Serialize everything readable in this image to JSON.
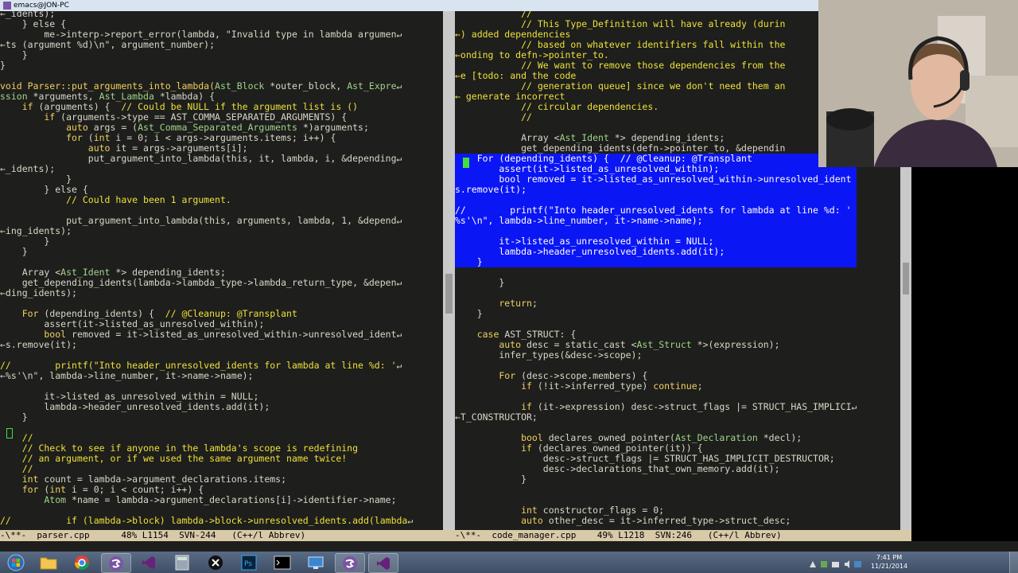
{
  "window": {
    "title": "emacs@JON-PC"
  },
  "colors": {
    "editor_bg": "#1e1e1c",
    "default_text": "#d8d8c8",
    "keyword_yellow": "#f0d060",
    "type_green": "#9fd48a",
    "comment_yellow": "#ede13a",
    "string_light": "#d8d8c8",
    "selection_blue": "#0b16f5",
    "modeline_bg": "#d8c9a8",
    "cursor_green": "#40e040"
  },
  "left_pane": {
    "lines": [
      [
        {
          "t": "←_idents);",
          "c": "n"
        }
      ],
      [
        {
          "t": "    } else {",
          "c": "n"
        }
      ],
      [
        {
          "t": "        me->interp->report_error(lambda, \"Invalid type in lambda argumen",
          "c": "n"
        },
        {
          "t": "↵",
          "c": "n"
        }
      ],
      [
        {
          "t": "←ts (argument %d)\\n\", argument_number);",
          "c": "n"
        }
      ],
      [
        {
          "t": "    }",
          "c": "n"
        }
      ],
      [
        {
          "t": "}",
          "c": "n"
        }
      ],
      [
        {
          "t": "",
          "c": "n"
        }
      ],
      [
        {
          "t": "void Parser::put_arguments_into_lambda(",
          "c": "k"
        },
        {
          "t": "Ast_Block",
          "c": "g"
        },
        {
          "t": " *outer_block, ",
          "c": "n"
        },
        {
          "t": "Ast_Expre",
          "c": "g"
        },
        {
          "t": "↵",
          "c": "n"
        }
      ],
      [
        {
          "t": "ssion",
          "c": "g"
        },
        {
          "t": " *arguments, ",
          "c": "n"
        },
        {
          "t": "Ast_Lambda",
          "c": "g"
        },
        {
          "t": " *lambda) {",
          "c": "n"
        }
      ],
      [
        {
          "t": "    if",
          "c": "k"
        },
        {
          "t": " (arguments) {  ",
          "c": "n"
        },
        {
          "t": "// Could be NULL if the argument list is ()",
          "c": "c"
        }
      ],
      [
        {
          "t": "        if",
          "c": "k"
        },
        {
          "t": " (arguments->type == AST_COMMA_SEPARATED_ARGUMENTS) {",
          "c": "n"
        }
      ],
      [
        {
          "t": "            auto",
          "c": "k"
        },
        {
          "t": " args = (",
          "c": "n"
        },
        {
          "t": "Ast_Comma_Separated_Arguments",
          "c": "g"
        },
        {
          "t": " *)arguments;",
          "c": "n"
        }
      ],
      [
        {
          "t": "            for",
          "c": "k"
        },
        {
          "t": " (",
          "c": "n"
        },
        {
          "t": "int",
          "c": "k"
        },
        {
          "t": " i = 0; i < args->arguments.items; i++) {",
          "c": "n"
        }
      ],
      [
        {
          "t": "                auto",
          "c": "k"
        },
        {
          "t": " it = args->arguments[i];",
          "c": "n"
        }
      ],
      [
        {
          "t": "                put_argument_into_lambda(this, it, lambda, i, &depending",
          "c": "n"
        },
        {
          "t": "↵",
          "c": "n"
        }
      ],
      [
        {
          "t": "←_idents);",
          "c": "n"
        }
      ],
      [
        {
          "t": "            }",
          "c": "n"
        }
      ],
      [
        {
          "t": "        } else {",
          "c": "n"
        }
      ],
      [
        {
          "t": "            ",
          "c": "n"
        },
        {
          "t": "// Could have been 1 argument.",
          "c": "c"
        }
      ],
      [
        {
          "t": "",
          "c": "n"
        }
      ],
      [
        {
          "t": "            put_argument_into_lambda(this, arguments, lambda, 1, &depend",
          "c": "n"
        },
        {
          "t": "↵",
          "c": "n"
        }
      ],
      [
        {
          "t": "←ing_idents);",
          "c": "n"
        }
      ],
      [
        {
          "t": "        }",
          "c": "n"
        }
      ],
      [
        {
          "t": "    }",
          "c": "n"
        }
      ],
      [
        {
          "t": "",
          "c": "n"
        }
      ],
      [
        {
          "t": "    Array <",
          "c": "n"
        },
        {
          "t": "Ast_Ident",
          "c": "g"
        },
        {
          "t": " *> depending_idents;",
          "c": "n"
        }
      ],
      [
        {
          "t": "    get_depending_idents(lambda->lambda_type->lambda_return_type, &depen",
          "c": "n"
        },
        {
          "t": "↵",
          "c": "n"
        }
      ],
      [
        {
          "t": "←ding_idents);",
          "c": "n"
        }
      ],
      [
        {
          "t": "",
          "c": "n"
        }
      ],
      [
        {
          "t": "    For",
          "c": "k"
        },
        {
          "t": " (depending_idents) {  ",
          "c": "n"
        },
        {
          "t": "// @Cleanup: @Transplant",
          "c": "c"
        }
      ],
      [
        {
          "t": "        assert(it->listed_as_unresolved_within);",
          "c": "n"
        }
      ],
      [
        {
          "t": "        bool",
          "c": "k"
        },
        {
          "t": " removed = it->listed_as_unresolved_within->unresolved_ident",
          "c": "n"
        },
        {
          "t": "↵",
          "c": "n"
        }
      ],
      [
        {
          "t": "←s.remove(it);",
          "c": "n"
        }
      ],
      [
        {
          "t": "",
          "c": "n"
        }
      ],
      [
        {
          "t": "//        printf(\"Into header_unresolved_idents for lambda at line %d: '",
          "c": "c"
        },
        {
          "t": "↵",
          "c": "n"
        }
      ],
      [
        {
          "t": "←%s'\\n\", lambda->line_number, it->name->name);",
          "c": "n"
        }
      ],
      [
        {
          "t": "",
          "c": "n"
        }
      ],
      [
        {
          "t": "        it->listed_as_unresolved_within = NULL;",
          "c": "n"
        }
      ],
      [
        {
          "t": "        lambda->header_unresolved_idents.add(it);",
          "c": "n"
        }
      ],
      [
        {
          "t": "    }",
          "c": "n"
        }
      ],
      [
        {
          "t": "",
          "c": "n"
        }
      ],
      [
        {
          "t": "    //",
          "c": "c"
        }
      ],
      [
        {
          "t": "    // Check to see if anyone in the lambda's scope is redefining",
          "c": "c"
        }
      ],
      [
        {
          "t": "    // an argument, or if we used the same argument name twice!",
          "c": "c"
        }
      ],
      [
        {
          "t": "    //",
          "c": "c"
        }
      ],
      [
        {
          "t": "    int",
          "c": "k"
        },
        {
          "t": " count = lambda->argument_declarations.items;",
          "c": "n"
        }
      ],
      [
        {
          "t": "    for",
          "c": "k"
        },
        {
          "t": " (",
          "c": "n"
        },
        {
          "t": "int",
          "c": "k"
        },
        {
          "t": " i = 0; i < count; i++) {",
          "c": "n"
        }
      ],
      [
        {
          "t": "        Atom",
          "c": "g"
        },
        {
          "t": " *name = lambda->argument_declarations[i]->identifier->name;",
          "c": "n"
        }
      ],
      [
        {
          "t": "",
          "c": "n"
        }
      ],
      [
        {
          "t": "//          if (lambda->block) lambda->block->unresolved_idents.add(lambda",
          "c": "c"
        },
        {
          "t": "↵",
          "c": "n"
        }
      ]
    ]
  },
  "right_pane": {
    "lines": [
      [
        {
          "t": "            //",
          "c": "c"
        }
      ],
      [
        {
          "t": "            // This Type_Definition will have already (durin",
          "c": "c"
        }
      ],
      [
        {
          "t": "←) added dependencies",
          "c": "c"
        }
      ],
      [
        {
          "t": "            // based on whatever identifiers fall within the",
          "c": "c"
        }
      ],
      [
        {
          "t": "←onding to defn->pointer_to.",
          "c": "c"
        }
      ],
      [
        {
          "t": "            // We want to remove those dependencies from the",
          "c": "c"
        }
      ],
      [
        {
          "t": "←e [todo: and the code",
          "c": "c"
        }
      ],
      [
        {
          "t": "            // generation queue] since we don't need them an",
          "c": "c"
        }
      ],
      [
        {
          "t": "← generate incorrect",
          "c": "c"
        }
      ],
      [
        {
          "t": "            // circular dependencies.",
          "c": "c"
        }
      ],
      [
        {
          "t": "            //",
          "c": "c"
        }
      ],
      [
        {
          "t": "",
          "c": "n"
        }
      ],
      [
        {
          "t": "            Array <",
          "c": "n"
        },
        {
          "t": "Ast_Ident",
          "c": "g"
        },
        {
          "t": " *> depending_idents;",
          "c": "n"
        }
      ],
      [
        {
          "t": "            get_depending_idents(defn->pointer_to, &dependin",
          "c": "n"
        }
      ],
      [
        {
          "t": "    For (depending_idents) {  // @Cleanup: @Transplant",
          "c": "n",
          "hl": true
        }
      ],
      [
        {
          "t": "        assert(it->listed_as_unresolved_within);",
          "c": "n",
          "hl": true
        }
      ],
      [
        {
          "t": "        bool removed = it->listed_as_unresolved_within->unresolved_ident",
          "c": "n",
          "hl": true
        }
      ],
      [
        {
          "t": "s.remove(it);",
          "c": "n",
          "hl": true
        }
      ],
      [
        {
          "t": "",
          "c": "n",
          "hl": true
        }
      ],
      [
        {
          "t": "//        printf(\"Into header_unresolved_idents for lambda at line %d: '",
          "c": "n",
          "hl": true
        }
      ],
      [
        {
          "t": "%s'\\n\", lambda->line_number, it->name->name);",
          "c": "n",
          "hl": true
        }
      ],
      [
        {
          "t": "",
          "c": "n",
          "hl": true
        }
      ],
      [
        {
          "t": "        it->listed_as_unresolved_within = NULL;",
          "c": "n",
          "hl": true
        }
      ],
      [
        {
          "t": "        lambda->header_unresolved_idents.add(it);",
          "c": "n",
          "hl": true
        }
      ],
      [
        {
          "t": "    }",
          "c": "n",
          "hl": true
        }
      ],
      [
        {
          "t": "",
          "c": "n"
        }
      ],
      [
        {
          "t": "        }",
          "c": "n"
        }
      ],
      [
        {
          "t": "",
          "c": "n"
        }
      ],
      [
        {
          "t": "        return",
          "c": "k"
        },
        {
          "t": ";",
          "c": "n"
        }
      ],
      [
        {
          "t": "    }",
          "c": "n"
        }
      ],
      [
        {
          "t": "",
          "c": "n"
        }
      ],
      [
        {
          "t": "    case",
          "c": "k"
        },
        {
          "t": " AST_STRUCT: {",
          "c": "n"
        }
      ],
      [
        {
          "t": "        auto",
          "c": "k"
        },
        {
          "t": " desc = static_cast <",
          "c": "n"
        },
        {
          "t": "Ast_Struct",
          "c": "g"
        },
        {
          "t": " *>(expression);",
          "c": "n"
        }
      ],
      [
        {
          "t": "        infer_types(&desc->scope);",
          "c": "n"
        }
      ],
      [
        {
          "t": "",
          "c": "n"
        }
      ],
      [
        {
          "t": "        For",
          "c": "k"
        },
        {
          "t": " (desc->scope.members) {",
          "c": "n"
        }
      ],
      [
        {
          "t": "            if",
          "c": "k"
        },
        {
          "t": " (!it->inferred_type) ",
          "c": "n"
        },
        {
          "t": "continue",
          "c": "k"
        },
        {
          "t": ";",
          "c": "n"
        }
      ],
      [
        {
          "t": "",
          "c": "n"
        }
      ],
      [
        {
          "t": "            if",
          "c": "k"
        },
        {
          "t": " (it->expression) desc->struct_flags |= STRUCT_HAS_IMPLICI",
          "c": "n"
        },
        {
          "t": "↵",
          "c": "n"
        }
      ],
      [
        {
          "t": "←T_CONSTRUCTOR;",
          "c": "n"
        }
      ],
      [
        {
          "t": "",
          "c": "n"
        }
      ],
      [
        {
          "t": "            bool",
          "c": "k"
        },
        {
          "t": " declares_owned_pointer(",
          "c": "n"
        },
        {
          "t": "Ast_Declaration",
          "c": "g"
        },
        {
          "t": " *decl);",
          "c": "n"
        }
      ],
      [
        {
          "t": "            if",
          "c": "k"
        },
        {
          "t": " (declares_owned_pointer(it)) {",
          "c": "n"
        }
      ],
      [
        {
          "t": "                desc->struct_flags |= STRUCT_HAS_IMPLICIT_DESTRUCTOR;",
          "c": "n"
        }
      ],
      [
        {
          "t": "                desc->declarations_that_own_memory.add(it);",
          "c": "n"
        }
      ],
      [
        {
          "t": "            }",
          "c": "n"
        }
      ],
      [
        {
          "t": "",
          "c": "n"
        }
      ],
      [
        {
          "t": "",
          "c": "n"
        }
      ],
      [
        {
          "t": "            int",
          "c": "k"
        },
        {
          "t": " constructor_flags = 0;",
          "c": "n"
        }
      ],
      [
        {
          "t": "            auto",
          "c": "k"
        },
        {
          "t": " other_desc = it->inferred_type->struct_desc;",
          "c": "n"
        }
      ]
    ]
  },
  "modeline_left": "-\\**-  parser.cpp      48% L1154  SVN-244   (C++/l Abbrev)",
  "modeline_right": "-\\**-  code_manager.cpp    49% L1218  SVN:246   (C++/l Abbrev)",
  "taskbar": {
    "buttons": [
      {
        "name": "start-button",
        "icon": "windows-logo"
      },
      {
        "name": "explorer-button",
        "icon": "folder-icon"
      },
      {
        "name": "chrome-button",
        "icon": "chrome-icon"
      },
      {
        "name": "emacs-button-1",
        "icon": "emacs-icon"
      },
      {
        "name": "visual-studio-button-1",
        "icon": "visual-studio-icon"
      },
      {
        "name": "calculator-button",
        "icon": "calculator-icon"
      },
      {
        "name": "app-button",
        "icon": "circle-app-icon"
      },
      {
        "name": "photoshop-button",
        "icon": "photoshop-icon"
      },
      {
        "name": "terminal-button",
        "icon": "terminal-icon"
      },
      {
        "name": "remote-button",
        "icon": "remote-desktop-icon"
      },
      {
        "name": "emacs-button-2",
        "icon": "emacs-icon"
      },
      {
        "name": "visual-studio-button-2",
        "icon": "visual-studio-icon"
      }
    ],
    "clock_time": "7:41 PM",
    "clock_date": "11/21/2014"
  }
}
